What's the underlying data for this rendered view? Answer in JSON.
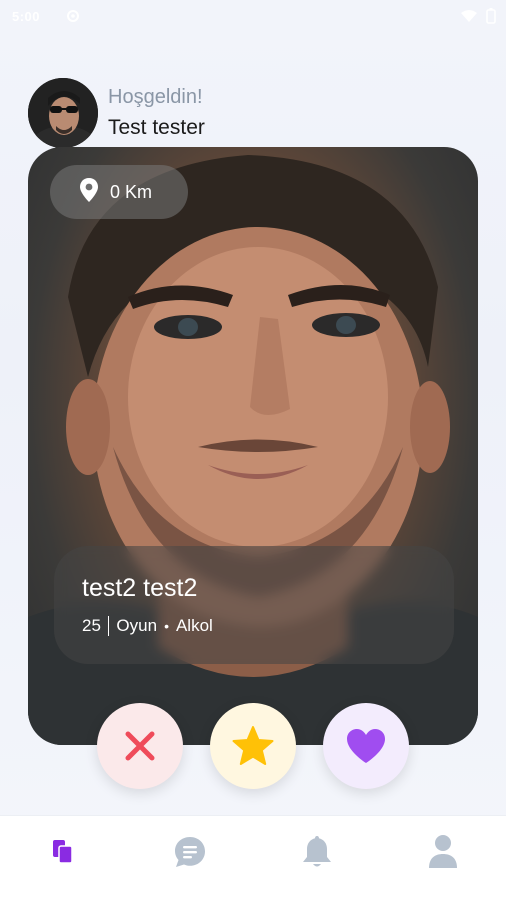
{
  "status_bar": {
    "time": "5:00"
  },
  "header": {
    "greeting": "Hoşgeldin!",
    "username": "Test tester"
  },
  "card": {
    "distance": "0 Km",
    "name": "test2 test2",
    "age": "25",
    "interest_1": "Oyun",
    "separator": "•",
    "interest_2": "Alkol"
  },
  "actions": {
    "nope_icon": "close-icon",
    "superlike_icon": "star-icon",
    "like_icon": "heart-icon"
  },
  "tabs": [
    {
      "icon": "cards-icon",
      "active": true
    },
    {
      "icon": "chat-icon",
      "active": false
    },
    {
      "icon": "bell-icon",
      "active": false
    },
    {
      "icon": "profile-icon",
      "active": false
    }
  ],
  "colors": {
    "accent": "#8a2be2",
    "nope": "#ef4b5a",
    "star": "#ffc107",
    "like": "#a04df0",
    "inactive_tab": "#b7c2cf"
  }
}
